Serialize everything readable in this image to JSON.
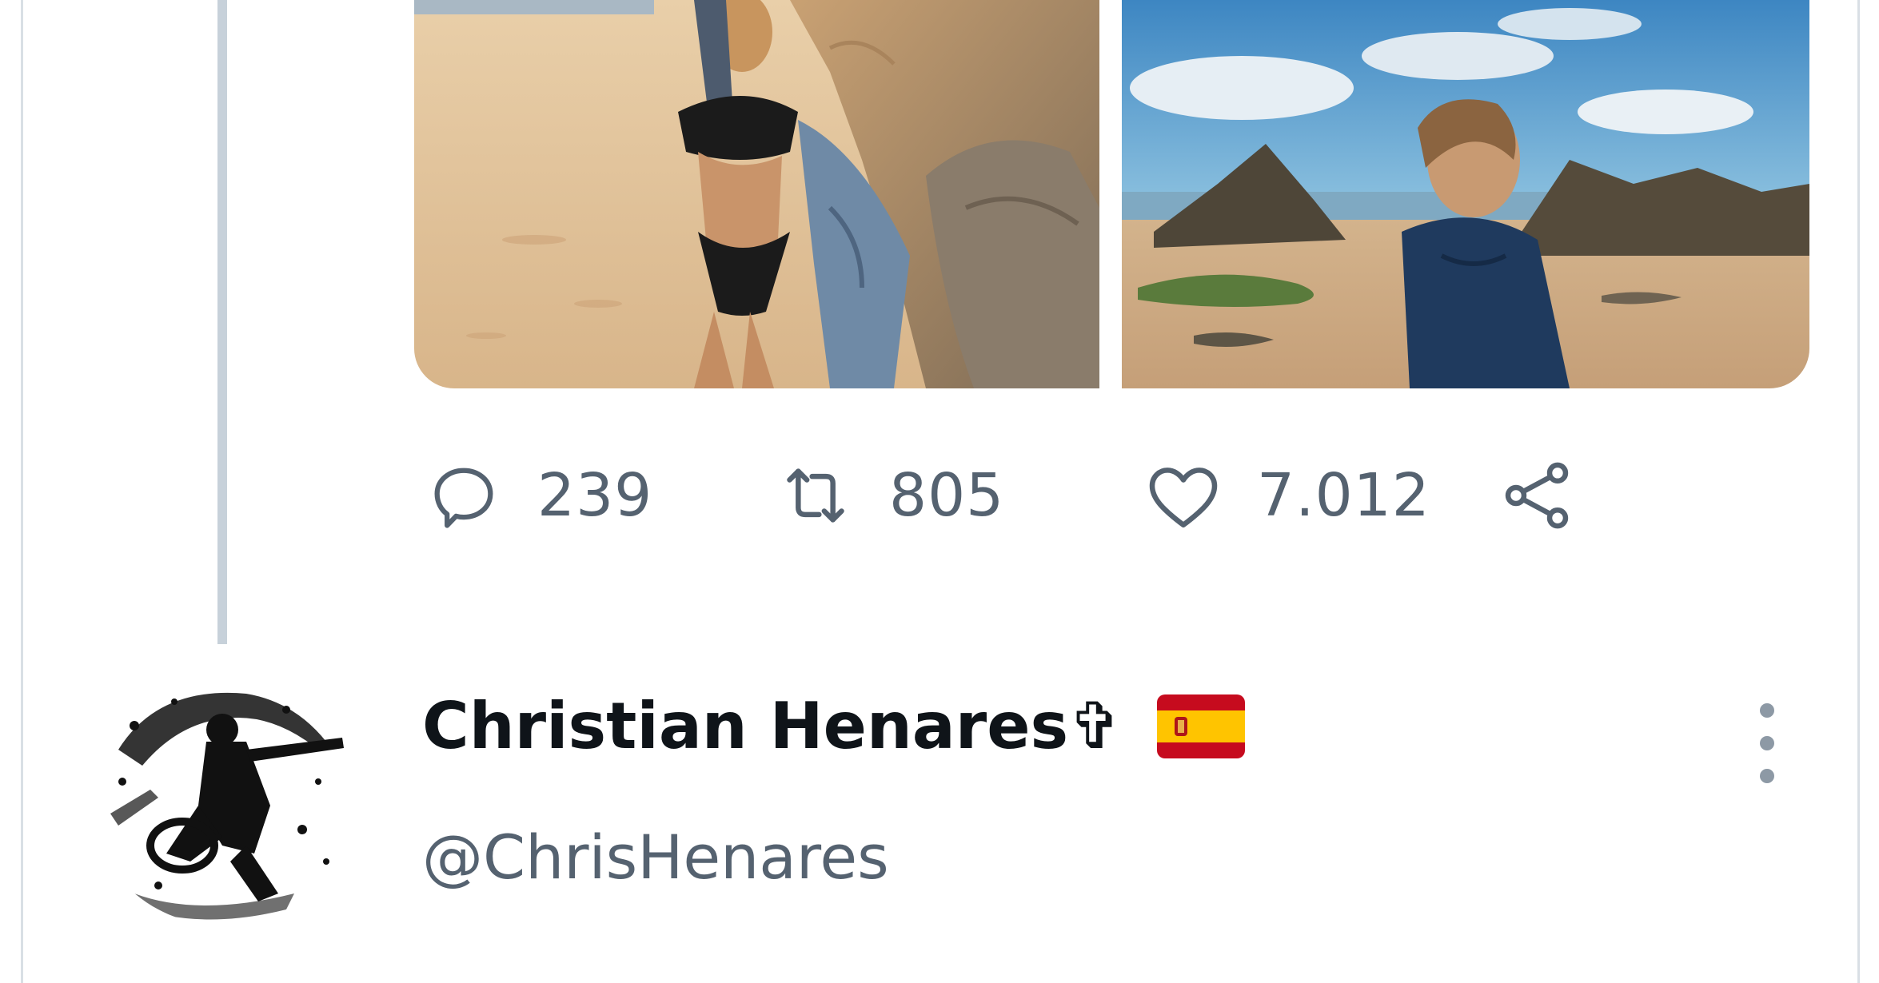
{
  "tweet": {
    "media": [
      {
        "label": "beach-photo-standing-by-rocks"
      },
      {
        "label": "beach-photo-looking-over-shoulder"
      }
    ],
    "actions": {
      "reply_count": "239",
      "retweet_count": "805",
      "like_count": "7.012"
    }
  },
  "reply": {
    "display_name": "Christian Henares",
    "name_symbol": "✞",
    "flag_icon": "spain-flag-icon",
    "handle": "@ChrisHenares"
  },
  "colors": {
    "text_primary": "#0f1419",
    "text_secondary": "#556270",
    "thread_line": "#c7d1da",
    "border": "#d9dfe5",
    "flag_red": "#c60b1e",
    "flag_yellow": "#ffc400"
  }
}
